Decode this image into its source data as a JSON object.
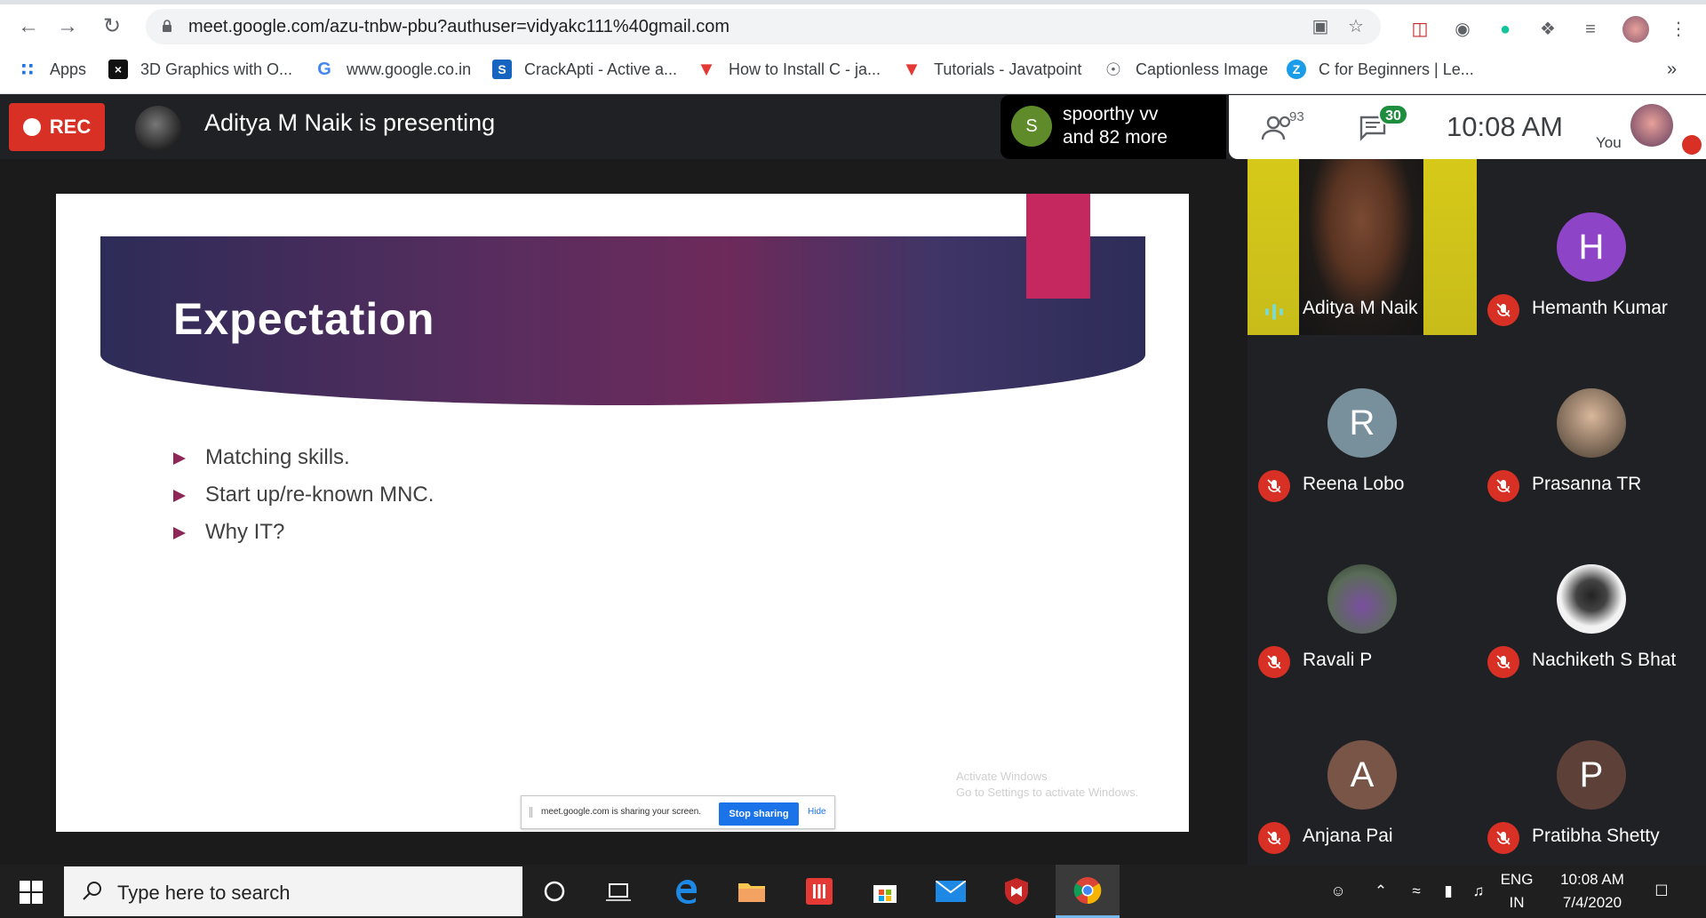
{
  "browser": {
    "url": "meet.google.com/azu-tnbw-pbu?authuser=vidyakc111%40gmail.com",
    "bookmarks": [
      {
        "label": "Apps",
        "icon": "apps-grid-icon",
        "color": "#1a73e8"
      },
      {
        "label": "3D Graphics with O...",
        "icon": "terminal-icon",
        "color": "#111111"
      },
      {
        "label": "www.google.co.in",
        "icon": "google-icon",
        "color": "#4285f4"
      },
      {
        "label": "CrackApti - Active a...",
        "icon": "s-logo-icon",
        "color": "#1565c0"
      },
      {
        "label": "How to Install C - ja...",
        "icon": "javatpoint-icon",
        "color": "#e53935"
      },
      {
        "label": "Tutorials - Javatpoint",
        "icon": "javatpoint-icon",
        "color": "#e53935"
      },
      {
        "label": "Captionless Image",
        "icon": "globe-icon",
        "color": "#5f6368"
      },
      {
        "label": "C for Beginners | Le...",
        "icon": "z-logo-icon",
        "color": "#1a9ce8"
      }
    ],
    "more_label": "»"
  },
  "meet": {
    "rec_label": "REC",
    "presenting_text": "Aditya M Naik is presenting",
    "others": {
      "initial": "S",
      "line1": "spoorthy vv",
      "line2": "and 82 more"
    },
    "people_count": "93",
    "chat_count": "30",
    "time": "10:08  AM",
    "you_label": "You"
  },
  "slide": {
    "title": "Expectation",
    "bullets": [
      "Matching skills.",
      "Start up/re-known MNC.",
      "Why IT?"
    ],
    "watermark_line1": "Activate Windows",
    "watermark_line2": "Go to Settings to activate Windows."
  },
  "share_bar": {
    "text": "meet.google.com is sharing your screen.",
    "stop_label": "Stop sharing",
    "hide_label": "Hide"
  },
  "participants": [
    {
      "name": "Aditya M Naik",
      "type": "video",
      "speaking": true
    },
    {
      "name": "Hemanth Kumar",
      "initial": "H",
      "color": "#8e44c7",
      "muted": true
    },
    {
      "name": "Reena Lobo",
      "initial": "R",
      "color": "#78909c",
      "muted": true
    },
    {
      "name": "Prasanna TR",
      "initial": "",
      "color": "#c9c1b5",
      "muted": true
    },
    {
      "name": "Ravali P",
      "initial": "",
      "color": "#6b7c6a",
      "muted": true
    },
    {
      "name": "Nachiketh S Bhat",
      "initial": "",
      "color": "#eeeeee",
      "muted": true
    },
    {
      "name": "Anjana Pai",
      "initial": "A",
      "color": "#795548",
      "muted": true
    },
    {
      "name": "Pratibha Shetty",
      "initial": "P",
      "color": "#5d4037",
      "muted": true
    }
  ],
  "taskbar": {
    "search_placeholder": "Type here to search",
    "lang_line1": "ENG",
    "lang_line2": "IN",
    "time": "10:08 AM",
    "date": "7/4/2020"
  }
}
